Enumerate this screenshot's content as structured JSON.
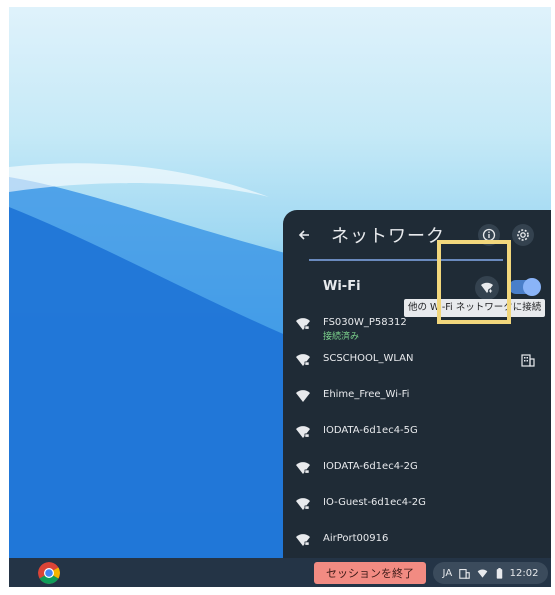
{
  "panel": {
    "title": "ネットワーク",
    "wifi_label": "Wi-Fi",
    "wifi_enabled": true,
    "join_tooltip": "他の Wi-Fi ネットワークに接続"
  },
  "networks": [
    {
      "name": "FS030W_P58312",
      "status": "接続済み",
      "secured": true,
      "enterprise": false
    },
    {
      "name": "SCSCHOOL_WLAN",
      "status": "",
      "secured": true,
      "enterprise": true
    },
    {
      "name": "Ehime_Free_Wi-Fi",
      "status": "",
      "secured": false,
      "enterprise": false
    },
    {
      "name": "IODATA-6d1ec4-5G",
      "status": "",
      "secured": true,
      "enterprise": false
    },
    {
      "name": "IODATA-6d1ec4-2G",
      "status": "",
      "secured": true,
      "enterprise": false
    },
    {
      "name": "IO-Guest-6d1ec4-2G",
      "status": "",
      "secured": true,
      "enterprise": false
    },
    {
      "name": "AirPort00916",
      "status": "",
      "secured": true,
      "enterprise": false
    }
  ],
  "shelf": {
    "end_session_label": "セッションを終了",
    "ime_label": "JA",
    "time": "12:02"
  },
  "colors": {
    "panel_bg": "#1f2b36",
    "accent": "#8ab4f8",
    "connected": "#7ed58e",
    "highlight": "#f2d77c",
    "end_session": "#f28b82"
  }
}
